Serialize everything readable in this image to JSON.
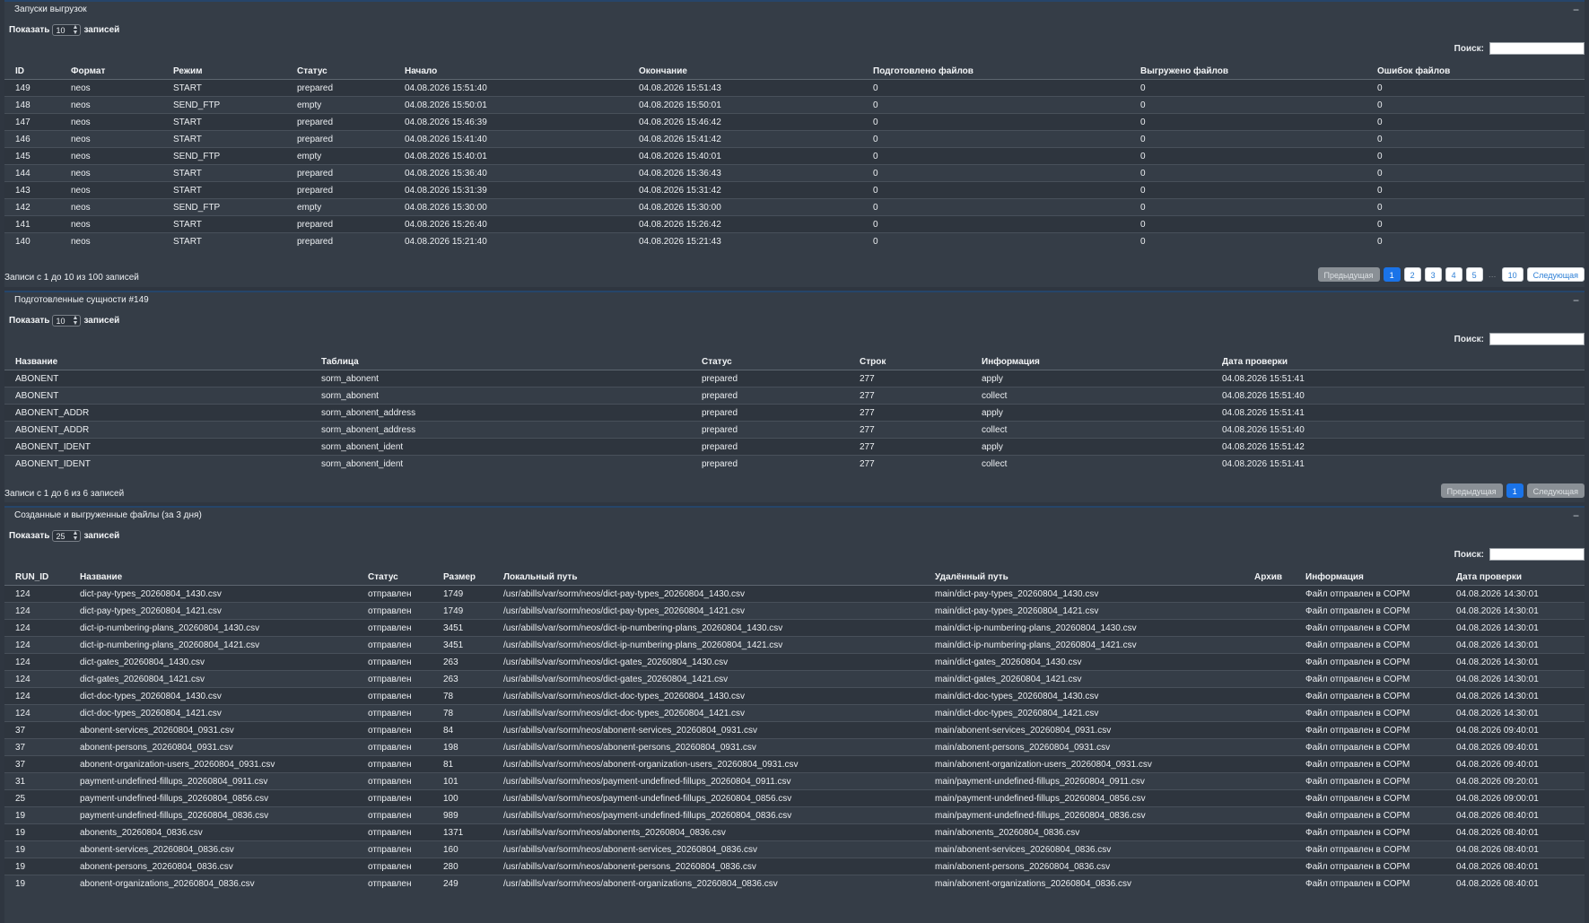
{
  "runs": {
    "title": "Запуски выгрузок",
    "collapse_icon": "−",
    "show_label": "Показать",
    "show_value": "10",
    "entries_label": "записей",
    "search_label": "Поиск:",
    "columns": [
      "ID",
      "Формат",
      "Режим",
      "Статус",
      "Начало",
      "Окончание",
      "Подготовлено файлов",
      "Выгружено файлов",
      "Ошибок файлов"
    ],
    "rows": [
      [
        "149",
        "neos",
        "START",
        "prepared",
        "04.08.2026 15:51:40",
        "04.08.2026 15:51:43",
        "0",
        "0",
        "0"
      ],
      [
        "148",
        "neos",
        "SEND_FTP",
        "empty",
        "04.08.2026 15:50:01",
        "04.08.2026 15:50:01",
        "0",
        "0",
        "0"
      ],
      [
        "147",
        "neos",
        "START",
        "prepared",
        "04.08.2026 15:46:39",
        "04.08.2026 15:46:42",
        "0",
        "0",
        "0"
      ],
      [
        "146",
        "neos",
        "START",
        "prepared",
        "04.08.2026 15:41:40",
        "04.08.2026 15:41:42",
        "0",
        "0",
        "0"
      ],
      [
        "145",
        "neos",
        "SEND_FTP",
        "empty",
        "04.08.2026 15:40:01",
        "04.08.2026 15:40:01",
        "0",
        "0",
        "0"
      ],
      [
        "144",
        "neos",
        "START",
        "prepared",
        "04.08.2026 15:36:40",
        "04.08.2026 15:36:43",
        "0",
        "0",
        "0"
      ],
      [
        "143",
        "neos",
        "START",
        "prepared",
        "04.08.2026 15:31:39",
        "04.08.2026 15:31:42",
        "0",
        "0",
        "0"
      ],
      [
        "142",
        "neos",
        "SEND_FTP",
        "empty",
        "04.08.2026 15:30:00",
        "04.08.2026 15:30:00",
        "0",
        "0",
        "0"
      ],
      [
        "141",
        "neos",
        "START",
        "prepared",
        "04.08.2026 15:26:40",
        "04.08.2026 15:26:42",
        "0",
        "0",
        "0"
      ],
      [
        "140",
        "neos",
        "START",
        "prepared",
        "04.08.2026 15:21:40",
        "04.08.2026 15:21:43",
        "0",
        "0",
        "0"
      ]
    ],
    "info": "Записи с 1 до 10 из 100 записей",
    "pager": {
      "prev": "Предыдущая",
      "pages": [
        "1",
        "2",
        "3",
        "4",
        "5"
      ],
      "ellipsis": "…",
      "last": "10",
      "next": "Следующая"
    }
  },
  "entities": {
    "title": "Подготовленные сущности #149",
    "collapse_icon": "−",
    "show_label": "Показать",
    "show_value": "10",
    "entries_label": "записей",
    "search_label": "Поиск:",
    "columns": [
      "Название",
      "Таблица",
      "Статус",
      "Строк",
      "Информация",
      "Дата проверки"
    ],
    "rows": [
      [
        "ABONENT",
        "sorm_abonent",
        "prepared",
        "277",
        "apply",
        "04.08.2026 15:51:41"
      ],
      [
        "ABONENT",
        "sorm_abonent",
        "prepared",
        "277",
        "collect",
        "04.08.2026 15:51:40"
      ],
      [
        "ABONENT_ADDR",
        "sorm_abonent_address",
        "prepared",
        "277",
        "apply",
        "04.08.2026 15:51:41"
      ],
      [
        "ABONENT_ADDR",
        "sorm_abonent_address",
        "prepared",
        "277",
        "collect",
        "04.08.2026 15:51:40"
      ],
      [
        "ABONENT_IDENT",
        "sorm_abonent_ident",
        "prepared",
        "277",
        "apply",
        "04.08.2026 15:51:42"
      ],
      [
        "ABONENT_IDENT",
        "sorm_abonent_ident",
        "prepared",
        "277",
        "collect",
        "04.08.2026 15:51:41"
      ]
    ],
    "info": "Записи с 1 до 6 из 6 записей",
    "pager": {
      "prev": "Предыдущая",
      "pages": [
        "1"
      ],
      "next": "Следующая"
    }
  },
  "files": {
    "title": "Созданные и выгруженные файлы (за 3 дня)",
    "collapse_icon": "−",
    "show_label": "Показать",
    "show_value": "25",
    "entries_label": "записей",
    "search_label": "Поиск:",
    "columns": [
      "RUN_ID",
      "Название",
      "Статус",
      "Размер",
      "Локальный путь",
      "Удалённый путь",
      "Архив",
      "Информация",
      "Дата проверки"
    ],
    "rows": [
      [
        "124",
        "dict-pay-types_20260804_1430.csv",
        "отправлен",
        "1749",
        "/usr/abills/var/sorm/neos/dict-pay-types_20260804_1430.csv",
        "main/dict-pay-types_20260804_1430.csv",
        "",
        "Файл отправлен в СОРМ",
        "04.08.2026 14:30:01"
      ],
      [
        "124",
        "dict-pay-types_20260804_1421.csv",
        "отправлен",
        "1749",
        "/usr/abills/var/sorm/neos/dict-pay-types_20260804_1421.csv",
        "main/dict-pay-types_20260804_1421.csv",
        "",
        "Файл отправлен в СОРМ",
        "04.08.2026 14:30:01"
      ],
      [
        "124",
        "dict-ip-numbering-plans_20260804_1430.csv",
        "отправлен",
        "3451",
        "/usr/abills/var/sorm/neos/dict-ip-numbering-plans_20260804_1430.csv",
        "main/dict-ip-numbering-plans_20260804_1430.csv",
        "",
        "Файл отправлен в СОРМ",
        "04.08.2026 14:30:01"
      ],
      [
        "124",
        "dict-ip-numbering-plans_20260804_1421.csv",
        "отправлен",
        "3451",
        "/usr/abills/var/sorm/neos/dict-ip-numbering-plans_20260804_1421.csv",
        "main/dict-ip-numbering-plans_20260804_1421.csv",
        "",
        "Файл отправлен в СОРМ",
        "04.08.2026 14:30:01"
      ],
      [
        "124",
        "dict-gates_20260804_1430.csv",
        "отправлен",
        "263",
        "/usr/abills/var/sorm/neos/dict-gates_20260804_1430.csv",
        "main/dict-gates_20260804_1430.csv",
        "",
        "Файл отправлен в СОРМ",
        "04.08.2026 14:30:01"
      ],
      [
        "124",
        "dict-gates_20260804_1421.csv",
        "отправлен",
        "263",
        "/usr/abills/var/sorm/neos/dict-gates_20260804_1421.csv",
        "main/dict-gates_20260804_1421.csv",
        "",
        "Файл отправлен в СОРМ",
        "04.08.2026 14:30:01"
      ],
      [
        "124",
        "dict-doc-types_20260804_1430.csv",
        "отправлен",
        "78",
        "/usr/abills/var/sorm/neos/dict-doc-types_20260804_1430.csv",
        "main/dict-doc-types_20260804_1430.csv",
        "",
        "Файл отправлен в СОРМ",
        "04.08.2026 14:30:01"
      ],
      [
        "124",
        "dict-doc-types_20260804_1421.csv",
        "отправлен",
        "78",
        "/usr/abills/var/sorm/neos/dict-doc-types_20260804_1421.csv",
        "main/dict-doc-types_20260804_1421.csv",
        "",
        "Файл отправлен в СОРМ",
        "04.08.2026 14:30:01"
      ],
      [
        "37",
        "abonent-services_20260804_0931.csv",
        "отправлен",
        "84",
        "/usr/abills/var/sorm/neos/abonent-services_20260804_0931.csv",
        "main/abonent-services_20260804_0931.csv",
        "",
        "Файл отправлен в СОРМ",
        "04.08.2026 09:40:01"
      ],
      [
        "37",
        "abonent-persons_20260804_0931.csv",
        "отправлен",
        "198",
        "/usr/abills/var/sorm/neos/abonent-persons_20260804_0931.csv",
        "main/abonent-persons_20260804_0931.csv",
        "",
        "Файл отправлен в СОРМ",
        "04.08.2026 09:40:01"
      ],
      [
        "37",
        "abonent-organization-users_20260804_0931.csv",
        "отправлен",
        "81",
        "/usr/abills/var/sorm/neos/abonent-organization-users_20260804_0931.csv",
        "main/abonent-organization-users_20260804_0931.csv",
        "",
        "Файл отправлен в СОРМ",
        "04.08.2026 09:40:01"
      ],
      [
        "31",
        "payment-undefined-fillups_20260804_0911.csv",
        "отправлен",
        "101",
        "/usr/abills/var/sorm/neos/payment-undefined-fillups_20260804_0911.csv",
        "main/payment-undefined-fillups_20260804_0911.csv",
        "",
        "Файл отправлен в СОРМ",
        "04.08.2026 09:20:01"
      ],
      [
        "25",
        "payment-undefined-fillups_20260804_0856.csv",
        "отправлен",
        "100",
        "/usr/abills/var/sorm/neos/payment-undefined-fillups_20260804_0856.csv",
        "main/payment-undefined-fillups_20260804_0856.csv",
        "",
        "Файл отправлен в СОРМ",
        "04.08.2026 09:00:01"
      ],
      [
        "19",
        "payment-undefined-fillups_20260804_0836.csv",
        "отправлен",
        "989",
        "/usr/abills/var/sorm/neos/payment-undefined-fillups_20260804_0836.csv",
        "main/payment-undefined-fillups_20260804_0836.csv",
        "",
        "Файл отправлен в СОРМ",
        "04.08.2026 08:40:01"
      ],
      [
        "19",
        "abonents_20260804_0836.csv",
        "отправлен",
        "1371",
        "/usr/abills/var/sorm/neos/abonents_20260804_0836.csv",
        "main/abonents_20260804_0836.csv",
        "",
        "Файл отправлен в СОРМ",
        "04.08.2026 08:40:01"
      ],
      [
        "19",
        "abonent-services_20260804_0836.csv",
        "отправлен",
        "160",
        "/usr/abills/var/sorm/neos/abonent-services_20260804_0836.csv",
        "main/abonent-services_20260804_0836.csv",
        "",
        "Файл отправлен в СОРМ",
        "04.08.2026 08:40:01"
      ],
      [
        "19",
        "abonent-persons_20260804_0836.csv",
        "отправлен",
        "280",
        "/usr/abills/var/sorm/neos/abonent-persons_20260804_0836.csv",
        "main/abonent-persons_20260804_0836.csv",
        "",
        "Файл отправлен в СОРМ",
        "04.08.2026 08:40:01"
      ],
      [
        "19",
        "abonent-organizations_20260804_0836.csv",
        "отправлен",
        "249",
        "/usr/abills/var/sorm/neos/abonent-organizations_20260804_0836.csv",
        "main/abonent-organizations_20260804_0836.csv",
        "",
        "Файл отправлен в СОРМ",
        "04.08.2026 08:40:01"
      ]
    ]
  },
  "colors": {
    "background": "#2f3640",
    "panel": "#353d47",
    "accent": "#1a73e8"
  }
}
